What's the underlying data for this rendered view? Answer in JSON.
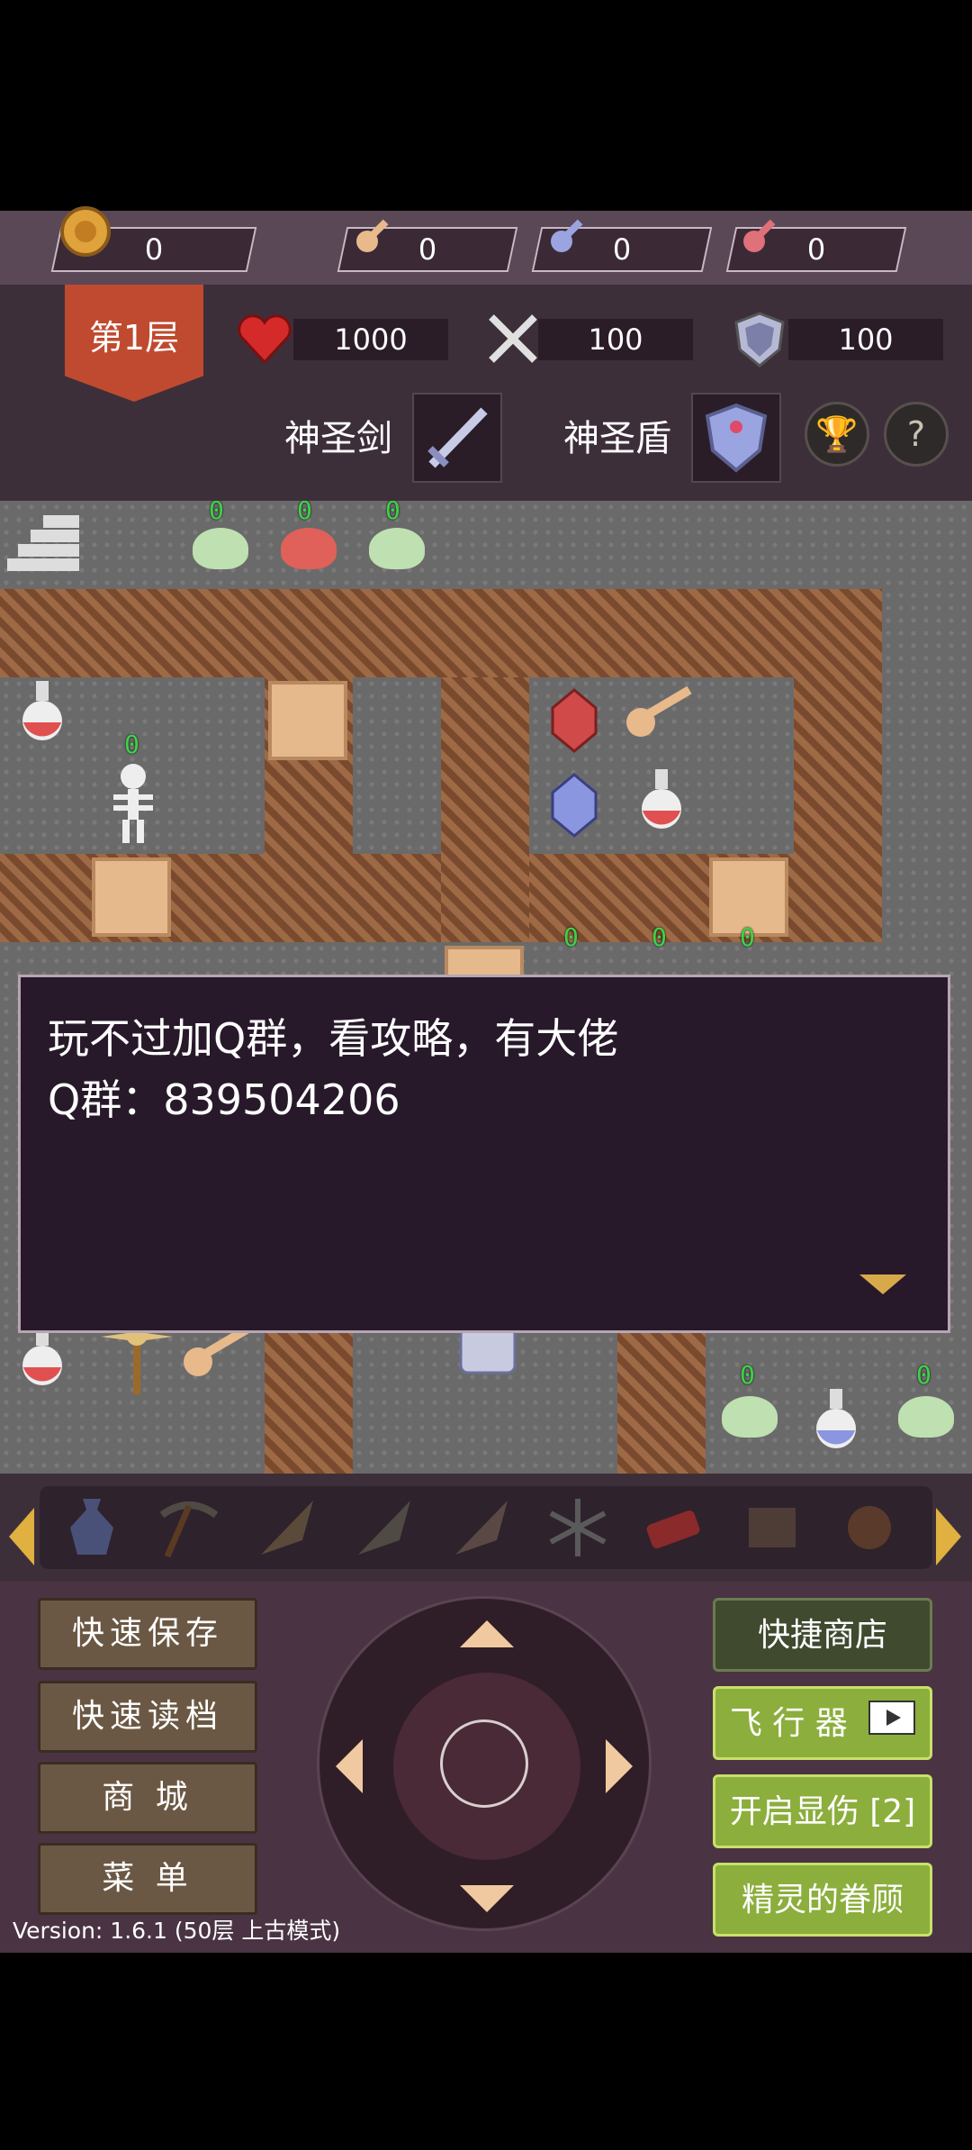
{
  "resources": [
    {
      "name": "coins",
      "icon": "coin-icon",
      "value": "0"
    },
    {
      "name": "yellow_keys",
      "icon": "yellow-key-icon",
      "value": "0"
    },
    {
      "name": "blue_keys",
      "icon": "blue-key-icon",
      "value": "0"
    },
    {
      "name": "red_keys",
      "icon": "red-key-icon",
      "value": "0"
    }
  ],
  "floor": {
    "label": "第1层"
  },
  "stats": {
    "hp": "1000",
    "attack": "100",
    "defense": "100"
  },
  "equipment": {
    "weapon_label": "神圣剑",
    "shield_label": "神圣盾"
  },
  "round_buttons": {
    "help": "?"
  },
  "monster_levels": [
    "0",
    "0",
    "0",
    "0",
    "0",
    "0",
    "0",
    "0",
    "0"
  ],
  "dialog": {
    "line1": "玩不过加Q群，看攻略，有大佬",
    "line2": "Q群：839504206"
  },
  "left_buttons": {
    "quick_save": "快速保存",
    "quick_load": "快速读档",
    "shop": "商 城",
    "menu": "菜 单"
  },
  "right_buttons": {
    "quick_shop": "快捷商店",
    "flyer": "飞 行 器",
    "show_damage": "开启显伤 [2]",
    "spirit": "精灵的眷顾"
  },
  "version": "Version: 1.6.1 (50层 上古模式)",
  "colors": {
    "accent_green": "#8cae3d",
    "banner_red": "#c04a2f",
    "monster_level": "#3fd14a"
  }
}
